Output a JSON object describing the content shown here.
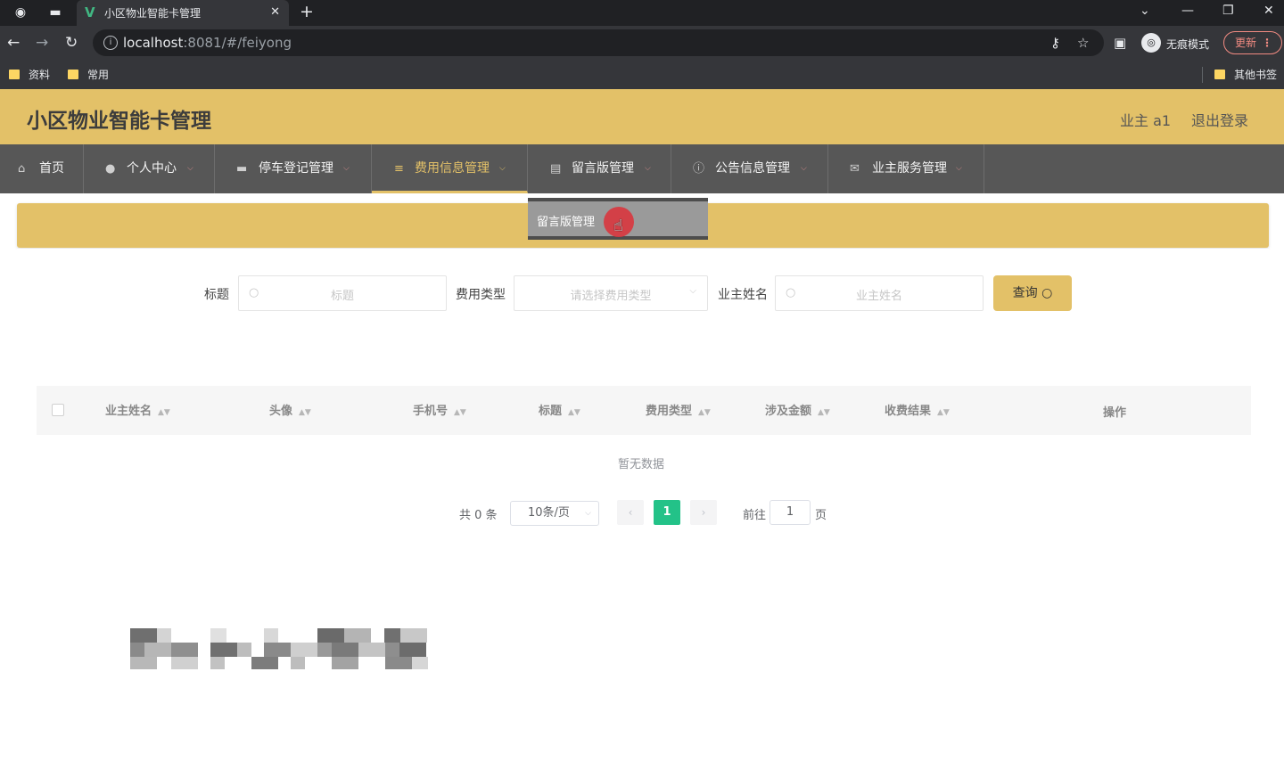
{
  "browser": {
    "tab_title": "小区物业智能卡管理",
    "tab_favicon": "V",
    "url_host": "localhost",
    "url_path": ":8081/#/feiyong",
    "incognito_label": "无痕模式",
    "update_label": "更新",
    "bookmarks": [
      "资料",
      "常用"
    ],
    "other_bookmarks": "其他书签"
  },
  "header": {
    "title": "小区物业智能卡管理",
    "user": "业主 a1",
    "logout": "退出登录",
    "accent_color": "#e3c168"
  },
  "nav": [
    {
      "label": "首页",
      "icon": "home-icon"
    },
    {
      "label": "个人中心",
      "icon": "user-icon"
    },
    {
      "label": "停车登记管理",
      "icon": "briefcase-icon"
    },
    {
      "label": "费用信息管理",
      "icon": "list-icon",
      "active": true
    },
    {
      "label": "留言版管理",
      "icon": "document-icon"
    },
    {
      "label": "公告信息管理",
      "icon": "info-icon"
    },
    {
      "label": "业主服务管理",
      "icon": "mail-icon"
    }
  ],
  "dropdown": {
    "item": "留言版管理"
  },
  "filters": {
    "title_label": "标题",
    "title_placeholder": "标题",
    "type_label": "费用类型",
    "type_placeholder": "请选择费用类型",
    "owner_label": "业主姓名",
    "owner_placeholder": "业主姓名",
    "query_button": "查询"
  },
  "table": {
    "columns": [
      "业主姓名",
      "头像",
      "手机号",
      "标题",
      "费用类型",
      "涉及金额",
      "收费结果",
      "操作"
    ],
    "empty_text": "暂无数据"
  },
  "pagination": {
    "total": "共 0 条",
    "page_size": "10条/页",
    "current_page": "1",
    "goto_label": "前往",
    "goto_value": "1",
    "page_suffix": "页"
  }
}
